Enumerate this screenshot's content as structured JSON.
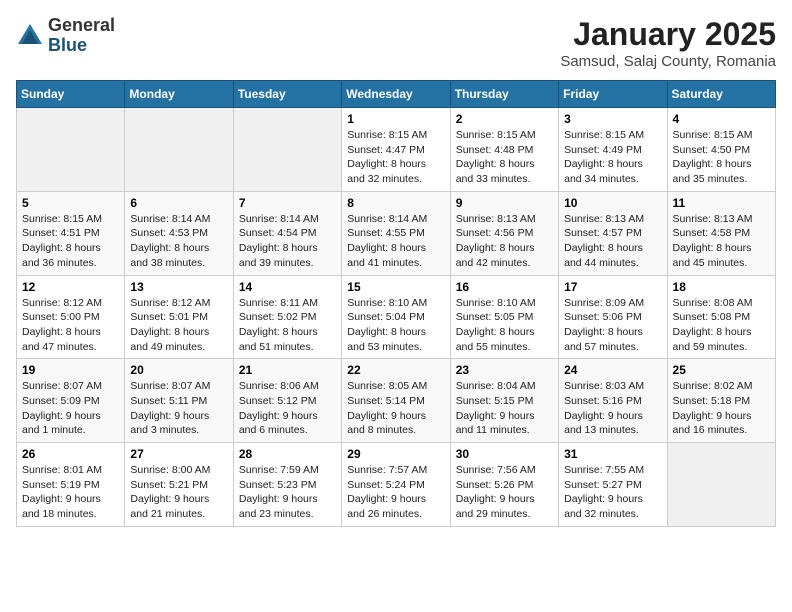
{
  "logo": {
    "general": "General",
    "blue": "Blue"
  },
  "title": "January 2025",
  "subtitle": "Samsud, Salaj County, Romania",
  "days_of_week": [
    "Sunday",
    "Monday",
    "Tuesday",
    "Wednesday",
    "Thursday",
    "Friday",
    "Saturday"
  ],
  "weeks": [
    [
      {
        "day": "",
        "info": ""
      },
      {
        "day": "",
        "info": ""
      },
      {
        "day": "",
        "info": ""
      },
      {
        "day": "1",
        "info": "Sunrise: 8:15 AM\nSunset: 4:47 PM\nDaylight: 8 hours and 32 minutes."
      },
      {
        "day": "2",
        "info": "Sunrise: 8:15 AM\nSunset: 4:48 PM\nDaylight: 8 hours and 33 minutes."
      },
      {
        "day": "3",
        "info": "Sunrise: 8:15 AM\nSunset: 4:49 PM\nDaylight: 8 hours and 34 minutes."
      },
      {
        "day": "4",
        "info": "Sunrise: 8:15 AM\nSunset: 4:50 PM\nDaylight: 8 hours and 35 minutes."
      }
    ],
    [
      {
        "day": "5",
        "info": "Sunrise: 8:15 AM\nSunset: 4:51 PM\nDaylight: 8 hours and 36 minutes."
      },
      {
        "day": "6",
        "info": "Sunrise: 8:14 AM\nSunset: 4:53 PM\nDaylight: 8 hours and 38 minutes."
      },
      {
        "day": "7",
        "info": "Sunrise: 8:14 AM\nSunset: 4:54 PM\nDaylight: 8 hours and 39 minutes."
      },
      {
        "day": "8",
        "info": "Sunrise: 8:14 AM\nSunset: 4:55 PM\nDaylight: 8 hours and 41 minutes."
      },
      {
        "day": "9",
        "info": "Sunrise: 8:13 AM\nSunset: 4:56 PM\nDaylight: 8 hours and 42 minutes."
      },
      {
        "day": "10",
        "info": "Sunrise: 8:13 AM\nSunset: 4:57 PM\nDaylight: 8 hours and 44 minutes."
      },
      {
        "day": "11",
        "info": "Sunrise: 8:13 AM\nSunset: 4:58 PM\nDaylight: 8 hours and 45 minutes."
      }
    ],
    [
      {
        "day": "12",
        "info": "Sunrise: 8:12 AM\nSunset: 5:00 PM\nDaylight: 8 hours and 47 minutes."
      },
      {
        "day": "13",
        "info": "Sunrise: 8:12 AM\nSunset: 5:01 PM\nDaylight: 8 hours and 49 minutes."
      },
      {
        "day": "14",
        "info": "Sunrise: 8:11 AM\nSunset: 5:02 PM\nDaylight: 8 hours and 51 minutes."
      },
      {
        "day": "15",
        "info": "Sunrise: 8:10 AM\nSunset: 5:04 PM\nDaylight: 8 hours and 53 minutes."
      },
      {
        "day": "16",
        "info": "Sunrise: 8:10 AM\nSunset: 5:05 PM\nDaylight: 8 hours and 55 minutes."
      },
      {
        "day": "17",
        "info": "Sunrise: 8:09 AM\nSunset: 5:06 PM\nDaylight: 8 hours and 57 minutes."
      },
      {
        "day": "18",
        "info": "Sunrise: 8:08 AM\nSunset: 5:08 PM\nDaylight: 8 hours and 59 minutes."
      }
    ],
    [
      {
        "day": "19",
        "info": "Sunrise: 8:07 AM\nSunset: 5:09 PM\nDaylight: 9 hours and 1 minute."
      },
      {
        "day": "20",
        "info": "Sunrise: 8:07 AM\nSunset: 5:11 PM\nDaylight: 9 hours and 3 minutes."
      },
      {
        "day": "21",
        "info": "Sunrise: 8:06 AM\nSunset: 5:12 PM\nDaylight: 9 hours and 6 minutes."
      },
      {
        "day": "22",
        "info": "Sunrise: 8:05 AM\nSunset: 5:14 PM\nDaylight: 9 hours and 8 minutes."
      },
      {
        "day": "23",
        "info": "Sunrise: 8:04 AM\nSunset: 5:15 PM\nDaylight: 9 hours and 11 minutes."
      },
      {
        "day": "24",
        "info": "Sunrise: 8:03 AM\nSunset: 5:16 PM\nDaylight: 9 hours and 13 minutes."
      },
      {
        "day": "25",
        "info": "Sunrise: 8:02 AM\nSunset: 5:18 PM\nDaylight: 9 hours and 16 minutes."
      }
    ],
    [
      {
        "day": "26",
        "info": "Sunrise: 8:01 AM\nSunset: 5:19 PM\nDaylight: 9 hours and 18 minutes."
      },
      {
        "day": "27",
        "info": "Sunrise: 8:00 AM\nSunset: 5:21 PM\nDaylight: 9 hours and 21 minutes."
      },
      {
        "day": "28",
        "info": "Sunrise: 7:59 AM\nSunset: 5:23 PM\nDaylight: 9 hours and 23 minutes."
      },
      {
        "day": "29",
        "info": "Sunrise: 7:57 AM\nSunset: 5:24 PM\nDaylight: 9 hours and 26 minutes."
      },
      {
        "day": "30",
        "info": "Sunrise: 7:56 AM\nSunset: 5:26 PM\nDaylight: 9 hours and 29 minutes."
      },
      {
        "day": "31",
        "info": "Sunrise: 7:55 AM\nSunset: 5:27 PM\nDaylight: 9 hours and 32 minutes."
      },
      {
        "day": "",
        "info": ""
      }
    ]
  ]
}
